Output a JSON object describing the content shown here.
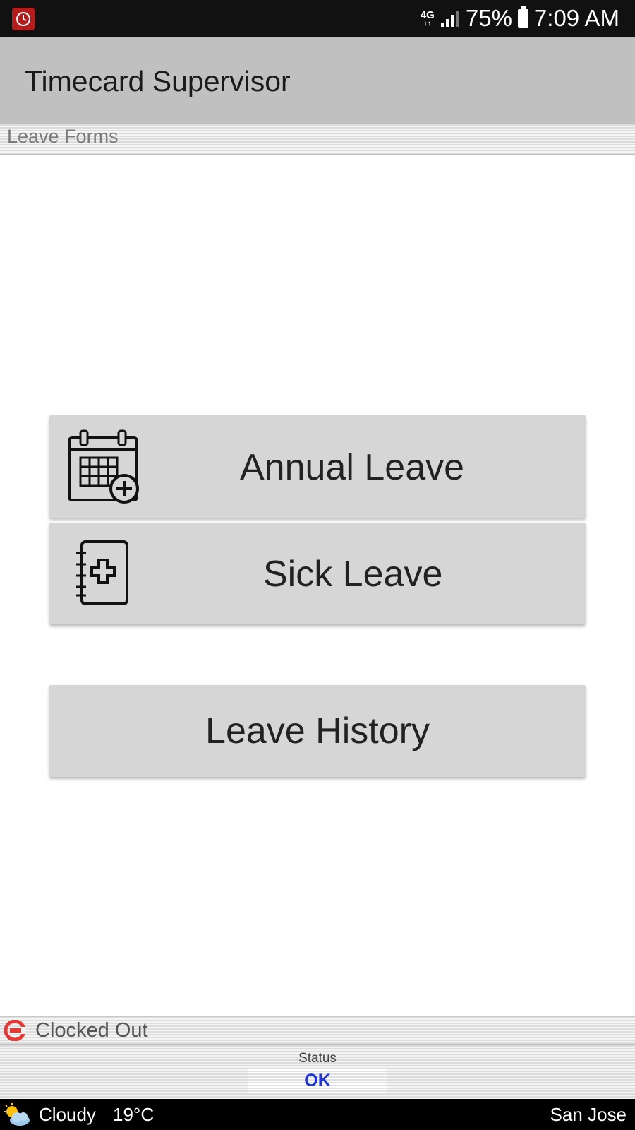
{
  "status_bar": {
    "network": "4G",
    "network_arrows": "↓↑",
    "battery": "75%",
    "time": "7:09 AM"
  },
  "app_bar": {
    "title": "Timecard Supervisor"
  },
  "section": {
    "title": "Leave Forms"
  },
  "buttons": {
    "annual": {
      "label": "Annual Leave",
      "icon": "calendar-add-icon"
    },
    "sick": {
      "label": "Sick Leave",
      "icon": "medical-notebook-icon"
    },
    "history": {
      "label": "Leave History"
    }
  },
  "clock_status": {
    "text": "Clocked Out",
    "icon": "clocked-out-icon",
    "color": "#e53935"
  },
  "status_panel": {
    "label": "Status",
    "value": "OK",
    "value_color": "#1a35e0"
  },
  "weather": {
    "condition": "Cloudy",
    "temperature": "19°C",
    "city": "San Jose",
    "icon": "partly-cloudy-icon"
  }
}
